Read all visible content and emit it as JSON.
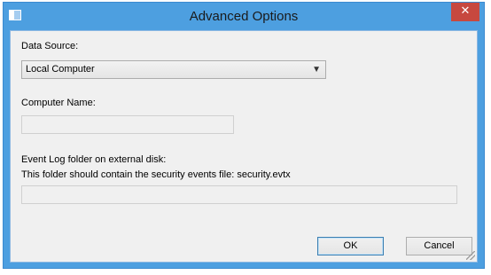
{
  "window": {
    "title": "Advanced Options",
    "close_glyph": "✕"
  },
  "form": {
    "data_source": {
      "label": "Data Source:",
      "selected": "Local Computer"
    },
    "computer_name": {
      "label": "Computer Name:",
      "value": ""
    },
    "event_log": {
      "label_line1": "Event Log folder on external disk:",
      "label_line2": "This folder should contain the security events file: security.evtx",
      "value": ""
    }
  },
  "buttons": {
    "ok": "OK",
    "cancel": "Cancel"
  },
  "colors": {
    "titlebar": "#4d9fe0",
    "close": "#c7483f",
    "client": "#f0f0f0"
  }
}
